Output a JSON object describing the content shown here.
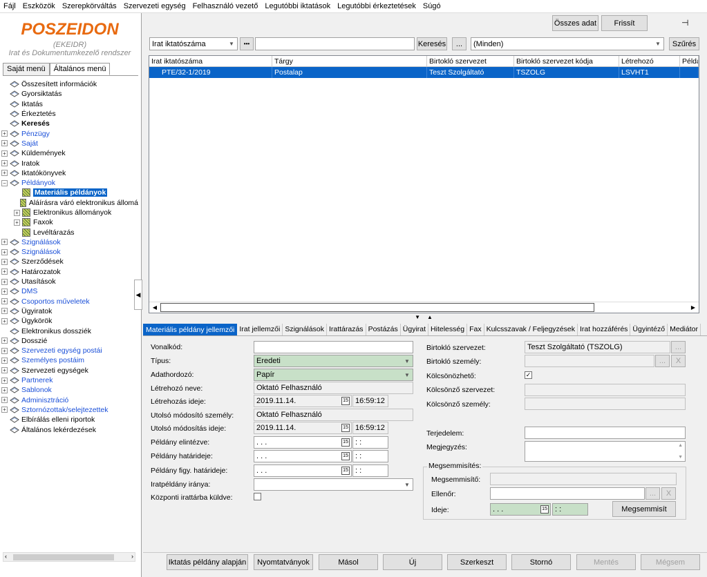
{
  "menu": [
    "Fájl",
    "Eszközök",
    "Szerepkörváltás",
    "Szervezeti egység",
    "Felhasználó vezető",
    "Legutóbbi iktatások",
    "Legutóbbi érkeztetések",
    "Súgó"
  ],
  "logo": {
    "brand": "POSZEIDON",
    "sub1": "(EKEIDR)",
    "sub2": "Irat és Dokumentumkezelő rendszer",
    "brand_color": "#e86a10"
  },
  "left_tabs": [
    "Saját menü",
    "Általános menü"
  ],
  "tree": [
    {
      "label": "Összesített információk",
      "exp": false,
      "level": 0
    },
    {
      "label": "Gyorsiktatás",
      "exp": false,
      "level": 0
    },
    {
      "label": "Iktatás",
      "exp": false,
      "level": 0
    },
    {
      "label": "Érkeztetés",
      "exp": false,
      "level": 0
    },
    {
      "label": "Keresés",
      "exp": false,
      "level": 0,
      "bold": true
    },
    {
      "label": "Pénzügy",
      "exp": "+",
      "level": 0,
      "blue": true
    },
    {
      "label": "Saját",
      "exp": "+",
      "level": 0,
      "blue": true
    },
    {
      "label": "Küldemények",
      "exp": "+",
      "level": 0
    },
    {
      "label": "Iratok",
      "exp": "+",
      "level": 0
    },
    {
      "label": "Iktatókönyvek",
      "exp": "+",
      "level": 0
    },
    {
      "label": "Példányok",
      "exp": "−",
      "level": 0,
      "blue": true
    },
    {
      "label": "Materiális példányok",
      "exp": false,
      "level": 1,
      "sel": true
    },
    {
      "label": "Aláírásra váró elektronikus állomá",
      "exp": false,
      "level": 1
    },
    {
      "label": "Elektronikus állományok",
      "exp": "+",
      "level": 1
    },
    {
      "label": "Faxok",
      "exp": "+",
      "level": 1
    },
    {
      "label": "Levéltárazás",
      "exp": false,
      "level": 1
    },
    {
      "label": "Szignálások",
      "exp": "+",
      "level": 0,
      "blue": true
    },
    {
      "label": "Szignálások",
      "exp": "+",
      "level": 0,
      "blue": true
    },
    {
      "label": "Szerződések",
      "exp": "+",
      "level": 0
    },
    {
      "label": "Határozatok",
      "exp": "+",
      "level": 0
    },
    {
      "label": "Utasítások",
      "exp": "+",
      "level": 0
    },
    {
      "label": "DMS",
      "exp": "+",
      "level": 0,
      "blue": true
    },
    {
      "label": "Csoportos műveletek",
      "exp": "+",
      "level": 0,
      "blue": true
    },
    {
      "label": "Ügyiratok",
      "exp": "+",
      "level": 0
    },
    {
      "label": "Ügykörök",
      "exp": "+",
      "level": 0
    },
    {
      "label": "Elektronikus dossziék",
      "exp": false,
      "level": 0
    },
    {
      "label": "Dosszié",
      "exp": "+",
      "level": 0
    },
    {
      "label": "Szervezeti egység postái",
      "exp": "+",
      "level": 0,
      "blue": true
    },
    {
      "label": "Személyes postáim",
      "exp": "+",
      "level": 0,
      "blue": true
    },
    {
      "label": "Szervezeti egységek",
      "exp": "+",
      "level": 0
    },
    {
      "label": "Partnerek",
      "exp": "+",
      "level": 0,
      "blue": true
    },
    {
      "label": "Sablonok",
      "exp": "+",
      "level": 0,
      "blue": true
    },
    {
      "label": "Adminisztráció",
      "exp": "+",
      "level": 0,
      "blue": true
    },
    {
      "label": "Sztornózottak/selejtezettek",
      "exp": "+",
      "level": 0,
      "blue": true
    },
    {
      "label": "Elbírálás elleni riportok",
      "exp": false,
      "level": 0
    },
    {
      "label": "Általános lekérdezések",
      "exp": false,
      "level": 0
    }
  ],
  "top_buttons": {
    "osszes": "Összes adat",
    "frissit": "Frissít"
  },
  "search": {
    "field_combo": "Irat iktatószáma",
    "dots": "•••",
    "value": "",
    "search_btn": "Keresés",
    "ellipsis": "...",
    "filter_combo": "(Minden)",
    "filter_btn": "Szűrés"
  },
  "grid": {
    "columns": [
      "Irat iktatószáma",
      "Tárgy",
      "Birtokló szervezet",
      "Birtokló szervezet kódja",
      "Létrehozó",
      "Példá"
    ],
    "rows": [
      [
        "PTE/32-1/2019",
        "Postalap",
        "Teszt Szolgáltató",
        "TSZOLG",
        "LSVHT1",
        ""
      ]
    ]
  },
  "detail_tabs": [
    "Materiális példány jellemzői",
    "Irat jellemzői",
    "Szignálások",
    "Irattárazás",
    "Postázás",
    "Ügyirat",
    "Hitelesség",
    "Fax",
    "Kulcsszavak / Feljegyzések",
    "Irat hozzáférés",
    "Ügyintéző",
    "Mediátor"
  ],
  "form": {
    "vonalkod_label": "Vonalkód:",
    "vonalkod": "",
    "tipus_label": "Típus:",
    "tipus": "Eredeti",
    "adathordozo_label": "Adathordozó:",
    "adathordozo": "Papír",
    "letrehozo_label": "Létrehozó neve:",
    "letrehozo": "Oktató Felhasználó",
    "letrehozas_label": "Létrehozás ideje:",
    "letrehozas_date": "2019.11.14.",
    "letrehozas_time": "16:59:12",
    "utolso_szem_label": "Utolsó módosító személy:",
    "utolso_szem": "Oktató Felhasználó",
    "utolso_ido_label": "Utolsó módosítás ideje:",
    "utolso_date": "2019.11.14.",
    "utolso_time": "16:59:12",
    "elintezve_label": "Példány elintézve:",
    "empty_date": " .  .  .",
    "empty_time": " :  :",
    "hatarido_label": "Példány határideje:",
    "figy_label": "Példány figy. határideje:",
    "iranya_label": "Iratpéldány iránya:",
    "kozponti_label": "Központi irattárba küldve:",
    "birt_szerv_label": "Birtokló szervezet:",
    "birt_szerv": "Teszt Szolgáltató (TSZOLG)",
    "birt_szem_label": "Birtokló személy:",
    "kolcson_label": "Kölcsönözhető:",
    "kolcson_check": "✓",
    "kolcson_szerv_label": "Kölcsönző szervezet:",
    "kolcson_szem_label": "Kölcsönző személy:",
    "terjedelem_label": "Terjedelem:",
    "megjegyzes_label": "Megjegyzés:",
    "megsem_group": "Megsemmisítés:",
    "megsemmisito_label": "Megsemmisítő:",
    "ellenor_label": "Ellenőr:",
    "ideje_label": "Ideje:",
    "megsemmisit_btn": "Megsemmisít",
    "ellipsis": "...",
    "x": "X"
  },
  "bottom_buttons": [
    "Iktatás példány alapján",
    "Nyomtatványok",
    "Másol",
    "Új",
    "Szerkeszt",
    "Stornó",
    "Mentés",
    "Mégsem"
  ]
}
